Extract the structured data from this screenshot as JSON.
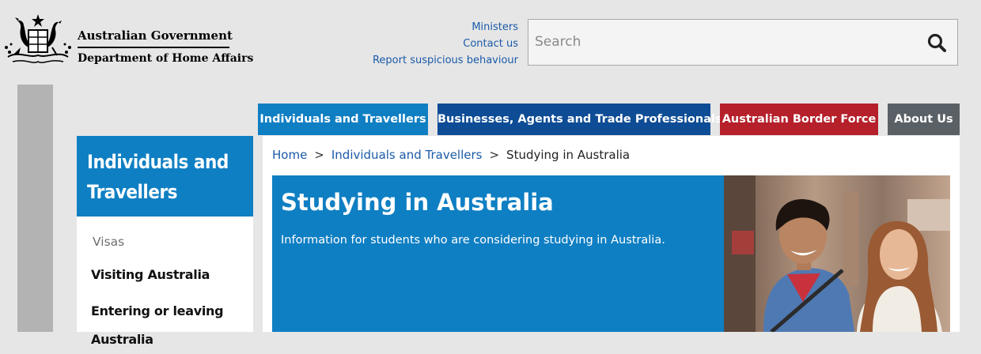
{
  "header": {
    "gov_name": "Australian Government",
    "dept_name": "Department of Home Affairs",
    "utility_links": [
      "Ministers",
      "Contact us",
      "Report suspicious behaviour"
    ],
    "search": {
      "placeholder": "Search"
    }
  },
  "nav": {
    "tabs": [
      {
        "label": "Individuals and Travellers",
        "color": "#0f7fc3"
      },
      {
        "label": "Businesses, Agents and Trade Professionals",
        "color": "#0e4c95"
      },
      {
        "label": "Australian Border Force",
        "color": "#b5202a"
      },
      {
        "label": "About Us",
        "color": "#5a6166"
      }
    ]
  },
  "sidebar": {
    "title": "Individuals and Travellers",
    "items": [
      "Visas",
      "Visiting Australia",
      "Entering or leaving Australia"
    ]
  },
  "breadcrumb": {
    "items": [
      "Home",
      "Individuals and Travellers",
      "Studying in Australia"
    ],
    "separator": ">"
  },
  "hero": {
    "title": "Studying in Australia",
    "text": "Information for students who are considering studying in Australia."
  },
  "colors": {
    "accent_blue": "#0f7fc3",
    "link_blue": "#1a5aa8"
  }
}
